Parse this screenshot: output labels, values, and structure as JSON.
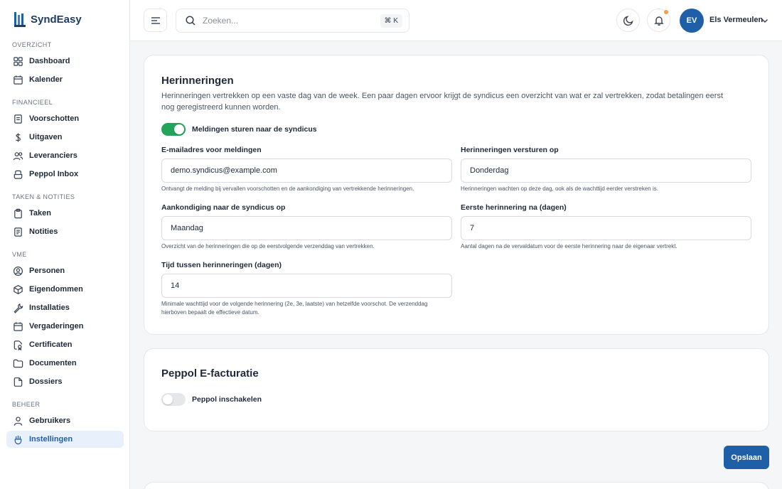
{
  "brand": {
    "name": "SyndEasy"
  },
  "sidebar": {
    "sections": [
      {
        "label": "Overzicht",
        "items": [
          {
            "label": "Dashboard",
            "icon": "grid-icon"
          },
          {
            "label": "Kalender",
            "icon": "calendar-icon"
          }
        ]
      },
      {
        "label": "Financieel",
        "items": [
          {
            "label": "Voorschotten",
            "icon": "document-icon"
          },
          {
            "label": "Uitgaven",
            "icon": "dollar-icon"
          },
          {
            "label": "Leveranciers",
            "icon": "users-icon"
          },
          {
            "label": "Peppol Inbox",
            "icon": "inbox-icon"
          }
        ]
      },
      {
        "label": "Taken & Notities",
        "items": [
          {
            "label": "Taken",
            "icon": "clipboard-icon"
          },
          {
            "label": "Notities",
            "icon": "note-icon"
          }
        ]
      },
      {
        "label": "VME",
        "items": [
          {
            "label": "Personen",
            "icon": "person-circle-icon"
          },
          {
            "label": "Eigendommen",
            "icon": "box-icon"
          },
          {
            "label": "Installaties",
            "icon": "wrench-icon"
          },
          {
            "label": "Vergaderingen",
            "icon": "calendar-icon"
          },
          {
            "label": "Certificaten",
            "icon": "certificate-icon"
          },
          {
            "label": "Documenten",
            "icon": "folder-icon"
          },
          {
            "label": "Dossiers",
            "icon": "file-icon"
          }
        ]
      },
      {
        "label": "Beheer",
        "items": [
          {
            "label": "Gebruikers",
            "icon": "user-icon"
          },
          {
            "label": "Instellingen",
            "icon": "settings-icon",
            "active": true
          }
        ]
      }
    ]
  },
  "header": {
    "search_placeholder": "Zoeken...",
    "shortcut": "⌘ K",
    "user": {
      "initials": "EV",
      "name": "Els Vermeulen"
    }
  },
  "reminders": {
    "title": "Herinneringen",
    "description": "Herinneringen vertrekken op een vaste dag van de week. Een paar dagen ervoor krijgt de syndicus een overzicht van wat er zal vertrekken, zodat betalingen eerst nog geregistreerd kunnen worden.",
    "toggle_label": "Meldingen sturen naar de syndicus",
    "toggle_on": true,
    "email": {
      "label": "E-mailadres voor meldingen",
      "value": "demo.syndicus@example.com",
      "help": "Ontvangt de melding bij vervallen voorschotten en de aankondiging van vertrekkende herinneringen."
    },
    "send_day": {
      "label": "Herinneringen versturen op",
      "value": "Donderdag",
      "help": "Herinneringen wachten op deze dag, ook als de wachttijd eerder verstreken is."
    },
    "announce_day": {
      "label": "Aankondiging naar de syndicus op",
      "value": "Maandag",
      "help": "Overzicht van de herinneringen die op de eerstvolgende verzenddag van vertrekken."
    },
    "first_reminder": {
      "label": "Eerste herinnering na (dagen)",
      "value": "7",
      "help": "Aantal dagen na de vervaldatum voor de eerste herinnering naar de eigenaar vertrekt."
    },
    "interval": {
      "label": "Tijd tussen herinneringen (dagen)",
      "value": "14",
      "help": "Minimale wachttijd voor de volgende herinnering (2e, 3e, laatste) van hetzelfde voorschot. De verzenddag hierboven bepaalt de effectieve datum."
    }
  },
  "peppol": {
    "title": "Peppol E-facturatie",
    "toggle_label": "Peppol inschakelen",
    "toggle_on": false
  },
  "actions": {
    "save_label": "Opslaan"
  },
  "colors": {
    "primary": "#1f5fa8",
    "toggle_on": "#22a55b",
    "notification_dot": "#f59e42"
  }
}
